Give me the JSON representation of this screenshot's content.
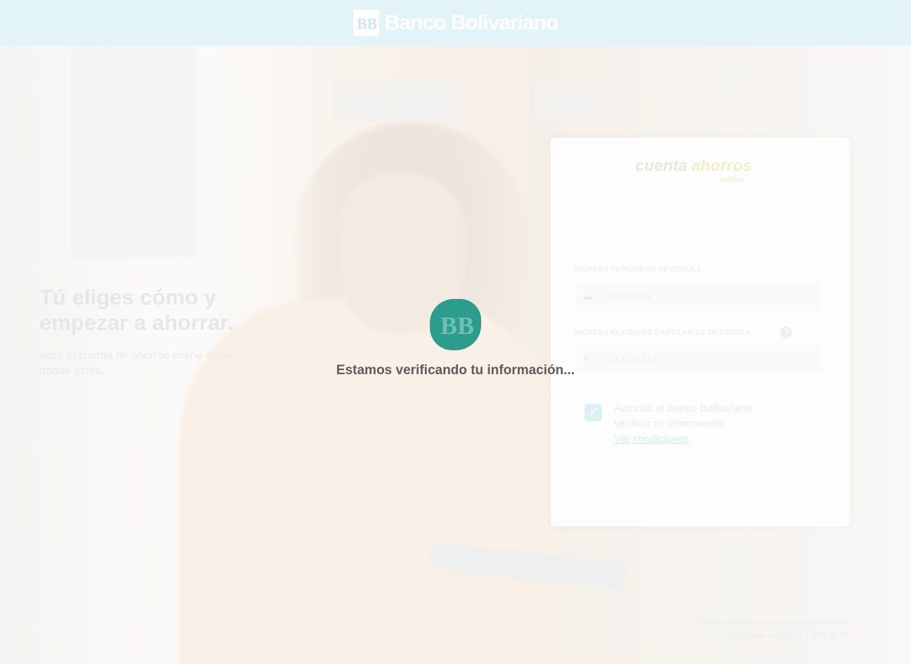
{
  "header": {
    "brand_name": "Banco Bolivariano",
    "brand_mark_icon": "bb-monogram-icon",
    "background_color": "#e3f4f8"
  },
  "hero": {
    "title": "Tú eliges cómo y empezar a ahorrar.",
    "subtitle": "Abre tu cuenta de ahorros online desde donde estés."
  },
  "form_card": {
    "logo": {
      "word1": "cuenta",
      "word2": "ahorros",
      "word3": "online"
    },
    "cedula_label": "INGRESA TU NÚMERO DE CÉDULA",
    "cedula_value": "09090909",
    "cedula_icon": "id-card-icon",
    "dactilar_label": "INGRESA EL CÓDIGO DACTILAR DE TU CÉDULA",
    "dactilar_value": "E12121212",
    "dactilar_icon": "fingerprint-icon",
    "help_icon": "question-icon",
    "help_glyph": "?",
    "checkbox_checked": true,
    "consent_text": "Autorizo al Banco Bolivariano verificar mi información.",
    "consent_link": "Ver condiciones"
  },
  "contact": {
    "line1": "¿Tienes problemas para abrir tu cuenta?",
    "line2": "Llámanos al Bolytel 1 800 00 00"
  },
  "loader": {
    "message": "Estamos verificando tu información...",
    "badge_color": "#2c9d8c",
    "badge_icon": "bb-monogram-icon"
  }
}
